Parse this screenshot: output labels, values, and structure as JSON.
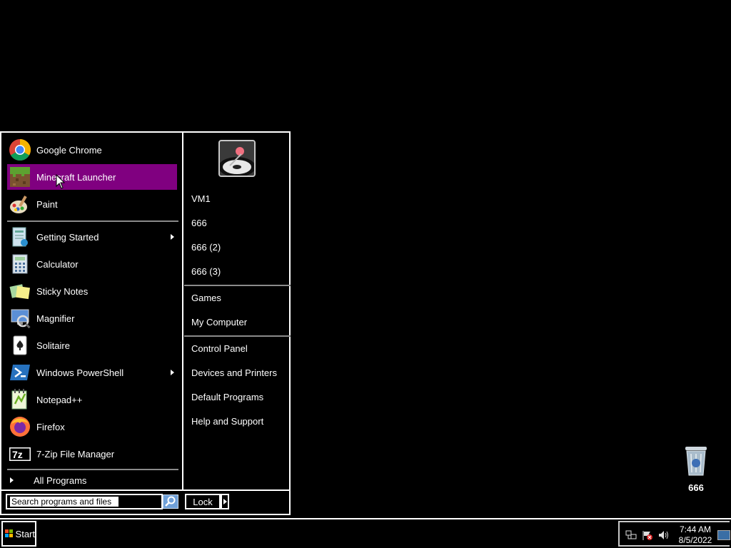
{
  "start_menu": {
    "pinned": [
      {
        "label": "Google Chrome",
        "icon": "chrome-icon"
      },
      {
        "label": "Minecraft Launcher",
        "icon": "minecraft-icon",
        "selected": true
      },
      {
        "label": "Paint",
        "icon": "paint-icon"
      }
    ],
    "recent": [
      {
        "label": "Getting Started",
        "icon": "getting-started-icon",
        "submenu": true
      },
      {
        "label": "Calculator",
        "icon": "calculator-icon"
      },
      {
        "label": "Sticky Notes",
        "icon": "sticky-notes-icon"
      },
      {
        "label": "Magnifier",
        "icon": "magnifier-icon"
      },
      {
        "label": "Solitaire",
        "icon": "solitaire-icon"
      },
      {
        "label": "Windows PowerShell",
        "icon": "powershell-icon",
        "submenu": true
      },
      {
        "label": "Notepad++",
        "icon": "notepadpp-icon"
      },
      {
        "label": "Firefox",
        "icon": "firefox-icon"
      },
      {
        "label": "7-Zip File Manager",
        "icon": "7zip-icon"
      }
    ],
    "all_programs": "All Programs",
    "search_placeholder": "Search programs and files",
    "lock_label": "Lock",
    "right": {
      "user_folders": [
        "VM1",
        "666",
        "666 (2)",
        "666 (3)"
      ],
      "places": [
        "Games",
        "My Computer"
      ],
      "system": [
        "Control Panel",
        "Devices and Printers",
        "Default Programs",
        "Help and Support"
      ]
    }
  },
  "desktop": {
    "recycle_bin_label": "666"
  },
  "taskbar": {
    "start_label": "Start",
    "time": "7:44 AM",
    "date": "8/5/2022"
  },
  "colors": {
    "selection": "#800080",
    "background": "#000000",
    "foreground": "#ffffff"
  }
}
